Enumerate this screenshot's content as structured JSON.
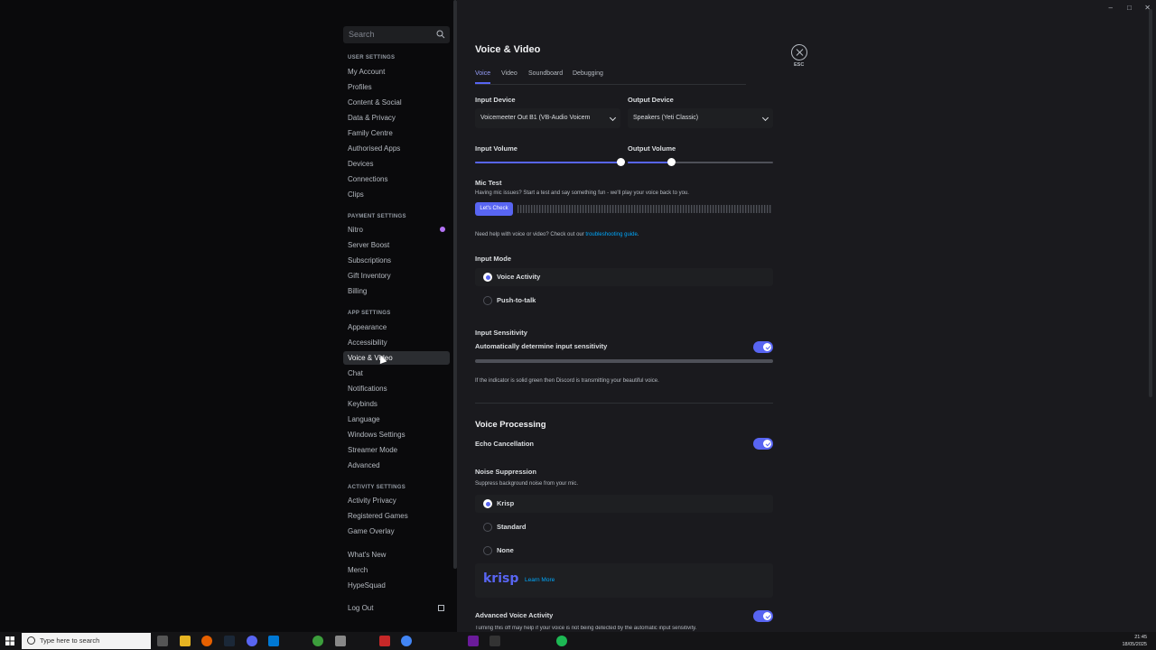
{
  "sidebar": {
    "search_placeholder": "Search",
    "user_settings_header": "USER SETTINGS",
    "user_settings": [
      "My Account",
      "Profiles",
      "Content & Social",
      "Data & Privacy",
      "Family Centre",
      "Authorised Apps",
      "Devices",
      "Connections",
      "Clips"
    ],
    "payment_settings_header": "PAYMENT SETTINGS",
    "payment_settings": [
      "Nitro",
      "Server Boost",
      "Subscriptions",
      "Gift Inventory",
      "Billing"
    ],
    "app_settings_header": "APP SETTINGS",
    "app_settings": [
      "Appearance",
      "Accessibility",
      "Voice & Video",
      "Chat",
      "Notifications",
      "Keybinds",
      "Language",
      "Windows Settings",
      "Streamer Mode",
      "Advanced"
    ],
    "activity_settings_header": "ACTIVITY SETTINGS",
    "activity_settings": [
      "Activity Privacy",
      "Registered Games",
      "Game Overlay"
    ],
    "misc": [
      "What's New",
      "Merch",
      "HypeSquad"
    ],
    "logout": "Log Out",
    "active_item": "Voice & Video"
  },
  "main": {
    "title": "Voice & Video",
    "tabs": [
      "Voice",
      "Video",
      "Soundboard",
      "Debugging"
    ],
    "active_tab": "Voice",
    "input_device_label": "Input Device",
    "input_device_value": "Voicemeeter Out B1 (VB-Audio Voicem",
    "output_device_label": "Output Device",
    "output_device_value": "Speakers (Yeti Classic)",
    "input_volume_label": "Input Volume",
    "input_volume": 100,
    "output_volume_label": "Output Volume",
    "output_volume": 30,
    "mic_test_title": "Mic Test",
    "mic_test_desc": "Having mic issues? Start a test and say something fun - we'll play your voice back to you.",
    "lets_check_button": "Let's Check",
    "help_text_prefix": "Need help with voice or video? Check out our ",
    "help_link": "troubleshooting guide",
    "help_text_suffix": ".",
    "input_mode_label": "Input Mode",
    "input_mode_options": [
      "Voice Activity",
      "Push-to-talk"
    ],
    "input_mode_selected": "Voice Activity",
    "input_sensitivity_label": "Input Sensitivity",
    "auto_sensitivity_label": "Automatically determine input sensitivity",
    "auto_sensitivity_on": true,
    "sensitivity_hint": "If the indicator is solid green then Discord is transmitting your beautiful voice.",
    "voice_processing_title": "Voice Processing",
    "echo_cancellation_label": "Echo Cancellation",
    "echo_cancellation_on": true,
    "noise_suppression_label": "Noise Suppression",
    "noise_suppression_desc": "Suppress background noise from your mic.",
    "noise_options": [
      "Krisp",
      "Standard",
      "None"
    ],
    "noise_selected": "Krisp",
    "krisp_logo": "krisp",
    "krisp_learn_more": "Learn More",
    "advanced_voice_activity_label": "Advanced Voice Activity",
    "advanced_voice_activity_on": true,
    "advanced_voice_activity_desc": "Turning this off may help if your voice is not being detected by the automatic input sensitivity.",
    "esc_label": "ESC"
  },
  "taskbar": {
    "search_placeholder": "Type here to search",
    "time": "21:45",
    "date": "18/05/2025"
  },
  "colors": {
    "accent": "#5865f2",
    "link": "#00a8fc",
    "background": "#1a1a1e",
    "sidebar": "#0a0a0c"
  }
}
